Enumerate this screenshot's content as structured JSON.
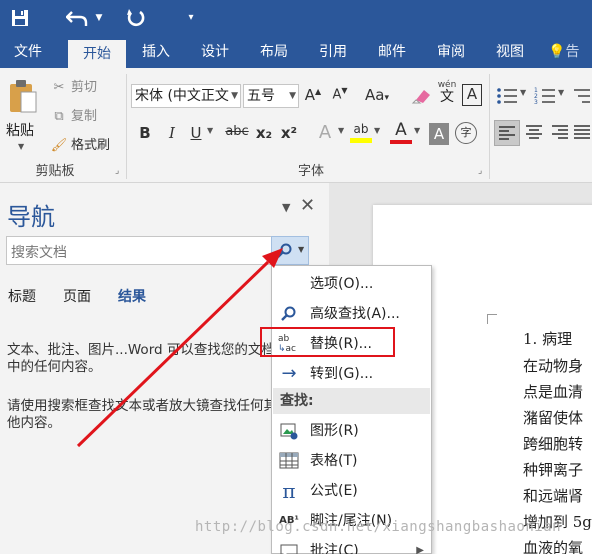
{
  "quick_access": {
    "save_icon": "save-icon",
    "undo_icon": "undo-icon",
    "redo_icon": "redo-icon",
    "customize_icon": "customize-qat-icon"
  },
  "tabs": [
    {
      "label": "文件"
    },
    {
      "label": "开始"
    },
    {
      "label": "插入"
    },
    {
      "label": "设计"
    },
    {
      "label": "布局"
    },
    {
      "label": "引用"
    },
    {
      "label": "邮件"
    },
    {
      "label": "审阅"
    },
    {
      "label": "视图"
    },
    {
      "label": "告"
    }
  ],
  "clipboard": {
    "paste_label": "粘贴",
    "cut_label": "剪切",
    "copy_label": "复制",
    "format_painter_label": "格式刷",
    "group_label": "剪贴板"
  },
  "font": {
    "font_name": "宋体 (中文正文",
    "font_size": "五号",
    "group_label": "字体",
    "bold": "B",
    "italic": "I",
    "underline": "U",
    "strike": "abc",
    "subscript": "x₂",
    "superscript": "x²",
    "grow": "A",
    "shrink": "A",
    "case": "Aa",
    "phonetic_top": "wén",
    "phonetic_bottom": "文",
    "border_char": "A",
    "text_effect": "A",
    "highlight": "ab",
    "font_color": "A",
    "char_shading": "A",
    "enclose": "字"
  },
  "nav": {
    "title": "导航",
    "search_placeholder": "搜索文档",
    "tabs": [
      "标题",
      "页面",
      "结果"
    ],
    "message1_line1": "文本、批注、图片...Word 可以查找您的文档",
    "message1_line2": "中的任何内容。",
    "message2_line1": "请使用搜索框查找文本或者放大镜查找任何其",
    "message2_line2": "他内容。"
  },
  "menu": {
    "items_top": [
      {
        "label": "选项(O)...",
        "icon": ""
      },
      {
        "label": "高级查找(A)...",
        "icon": "search-icon"
      },
      {
        "label": "替换(R)...",
        "icon": "replace-icon"
      },
      {
        "label": "转到(G)...",
        "icon": "goto-arrow-icon"
      }
    ],
    "find_header": "查找:",
    "items_find": [
      {
        "label": "图形(R)",
        "icon": "graphic-icon"
      },
      {
        "label": "表格(T)",
        "icon": "table-icon"
      },
      {
        "label": "公式(E)",
        "icon": "equation-icon"
      },
      {
        "label": "脚注/尾注(N)",
        "icon": "footnote-icon"
      },
      {
        "label": "批注(C)",
        "icon": "comment-icon"
      }
    ],
    "icon_glyphs": {
      "replace_top": "ab",
      "replace_bottom": "ac",
      "pi": "π",
      "footnote": "AB¹"
    }
  },
  "document": {
    "lines": [
      "1.   病理",
      "在动物身",
      "点是血清",
      "潴留使体",
      "跨细胞转",
      "种钾离子",
      "和远端肾",
      "增加到 5g",
      "血液的氧"
    ]
  },
  "watermark": "http://blog.csdn.net/xiangshangbashaonian",
  "colors": {
    "accent": "#2b579a",
    "ribbon_bg": "#f3f3f3",
    "highlight_box": "#e0141b",
    "arrow": "#e0141b"
  }
}
